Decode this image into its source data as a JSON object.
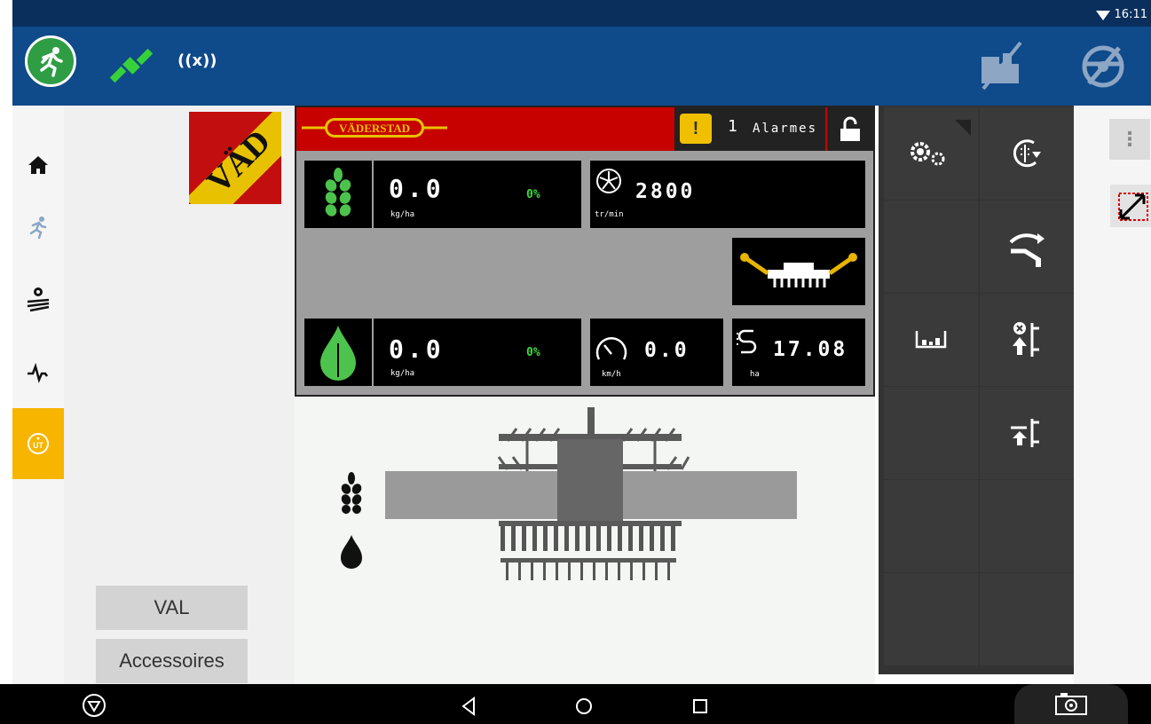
{
  "status_bar": {
    "time": "16:11"
  },
  "top_bar": {
    "signal_label": "((x))"
  },
  "left_nav": {
    "items": [
      {
        "name": "home-icon"
      },
      {
        "name": "running-icon"
      },
      {
        "name": "field-settings-icon"
      },
      {
        "name": "activity-icon"
      },
      {
        "name": "ut-icon",
        "label": "UT",
        "active": true
      }
    ]
  },
  "side_buttons": {
    "val_label": "VAL",
    "accessories_label": "Accessoires"
  },
  "terminal": {
    "brand": "VÄDERSTAD",
    "logo_text": "VÄD",
    "alarm": {
      "badge": "!",
      "count": "1",
      "label": "Alarmes"
    },
    "seed_rate": {
      "value": "0.0",
      "unit": "kg/ha",
      "percent": "0%"
    },
    "fan": {
      "value": "2800",
      "unit": "tr/min"
    },
    "fert_rate": {
      "value": "0.0",
      "unit": "kg/ha",
      "percent": "0%"
    },
    "speed": {
      "value": "0.0",
      "unit": "km/h"
    },
    "area": {
      "value": "17.08",
      "unit": "ha"
    }
  },
  "colors": {
    "top_bar": "#0f4a8a",
    "status_bar": "#0b2f5c",
    "accent_green": "#2f9d44",
    "brand_red": "#c70000",
    "ut_active": "#f7b500",
    "value_green": "#3ddc3d",
    "alarm_yellow": "#f0c000"
  }
}
